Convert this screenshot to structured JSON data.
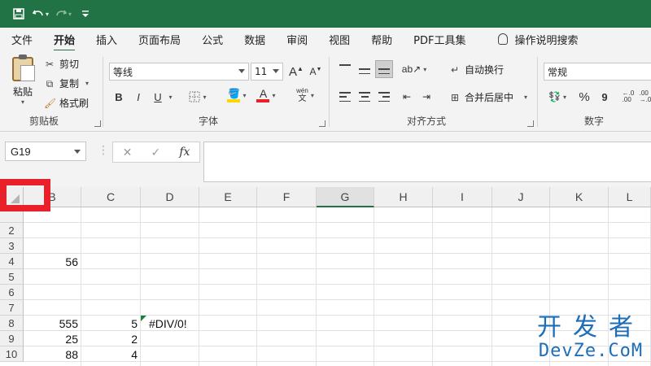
{
  "quick_access": {
    "save_icon": "save-icon",
    "undo_icon": "undo-icon",
    "redo_icon": "redo-icon",
    "customize_icon": "customize-qat-icon"
  },
  "tabs": [
    {
      "label": "文件"
    },
    {
      "label": "开始"
    },
    {
      "label": "插入"
    },
    {
      "label": "页面布局"
    },
    {
      "label": "公式"
    },
    {
      "label": "数据"
    },
    {
      "label": "审阅"
    },
    {
      "label": "视图"
    },
    {
      "label": "帮助"
    },
    {
      "label": "PDF工具集"
    }
  ],
  "tell_me": "操作说明搜索",
  "ribbon": {
    "clipboard": {
      "paste": "粘贴",
      "cut": "剪切",
      "copy": "复制",
      "format_painter": "格式刷",
      "label": "剪贴板"
    },
    "font": {
      "name": "等线",
      "size": "11",
      "bold": "B",
      "italic": "I",
      "underline": "U",
      "label": "字体",
      "font_color": "#e8202a",
      "fill_color": "#ffd700"
    },
    "alignment": {
      "wrap_text": "自动换行",
      "merge_center": "合并后居中",
      "label": "对齐方式"
    },
    "number": {
      "format": "常规",
      "percent": "%",
      "comma": "9",
      "label": "数字"
    }
  },
  "formula_bar": {
    "name_box": "G19",
    "cancel": "✕",
    "enter": "✓",
    "fx": "fx",
    "formula": ""
  },
  "columns": [
    "B",
    "C",
    "D",
    "E",
    "F",
    "G",
    "H",
    "I",
    "J",
    "K",
    "L"
  ],
  "selected_column": "G",
  "rows": [
    "2",
    "3",
    "4",
    "5",
    "6",
    "7",
    "8",
    "9",
    "10"
  ],
  "cells": {
    "B4": "56",
    "B8": "555",
    "C8": "5",
    "D8": "#DIV/0!",
    "B9": "25",
    "C9": "2",
    "B10": "88",
    "C10": "4"
  },
  "watermark": {
    "cn": "开发者",
    "en": "DevZe.CoM"
  },
  "colors": {
    "accent": "#217346",
    "highlight": "#e8202a",
    "watermark": "#1d6eb8"
  }
}
